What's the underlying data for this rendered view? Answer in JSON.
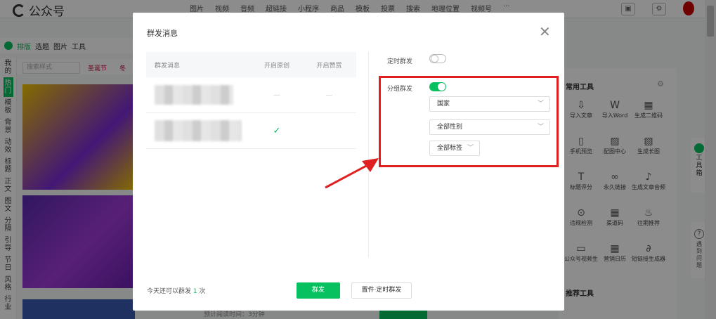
{
  "header": {
    "app_name": "公众号",
    "toolbar": [
      "图片",
      "视频",
      "音频",
      "超链接",
      "小程序",
      "商品",
      "模板",
      "投票",
      "搜索",
      "地理位置",
      "视频号",
      "···"
    ]
  },
  "left": {
    "tabs": [
      "排版",
      "选题",
      "图片",
      "工具"
    ],
    "vertical_tabs": [
      "我的",
      "热门",
      "模板",
      "背景",
      "动效",
      "标题",
      "正文",
      "图文",
      "分隔",
      "引导",
      "节日",
      "风格",
      "行业"
    ],
    "search_placeholder": "搜索样式",
    "tags": [
      "圣诞节",
      "冬"
    ]
  },
  "right_panel": {
    "title": "常用工具",
    "tools": [
      "导入文章",
      "导入Word",
      "生成二维码",
      "手机预览",
      "配图中心",
      "生成长图",
      "标题评分",
      "永久链接",
      "生成文章音频",
      "违规检测",
      "渠道码",
      "往期推荐",
      "公众号视频生成",
      "营销日历",
      "短链接生成器"
    ],
    "recommend_title": "推荐工具"
  },
  "floating": {
    "toolbox": "工具箱",
    "help": "遇到问题"
  },
  "dialog": {
    "title": "群发消息",
    "table": {
      "headers": [
        "群发消息",
        "开启原创",
        "开启赞赏"
      ],
      "rows": [
        {
          "original": "—",
          "reward": "—"
        },
        {
          "original": "✓",
          "reward": ""
        }
      ]
    },
    "schedule_label": "定时群发",
    "group_label": "分组群发",
    "country_select": "国家",
    "gender_select": "全部性别",
    "tag_select": "全部标签",
    "footer": {
      "prefix": "今天还可以群发",
      "count": "1",
      "suffix": "次"
    },
    "send_button": "群发",
    "schedule_button": "置件·定时群发"
  },
  "bottom_text": "预计阅读时间：3分钟",
  "colors": {
    "accent": "#07c160",
    "highlight": "#e02020"
  }
}
